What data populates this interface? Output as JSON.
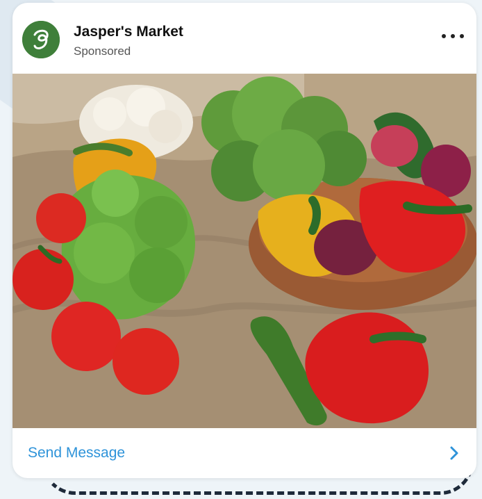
{
  "ad": {
    "brand_name": "Jasper's Market",
    "label": "Sponsored",
    "cta_label": "Send Message",
    "logo_icon": "jasper-script-j-logo",
    "more_icon": "ellipsis-icon",
    "chevron_icon": "chevron-right-icon",
    "image_subject": "fresh vegetables"
  },
  "colors": {
    "brand": "#3f7f3a",
    "cta": "#2e93d9"
  }
}
